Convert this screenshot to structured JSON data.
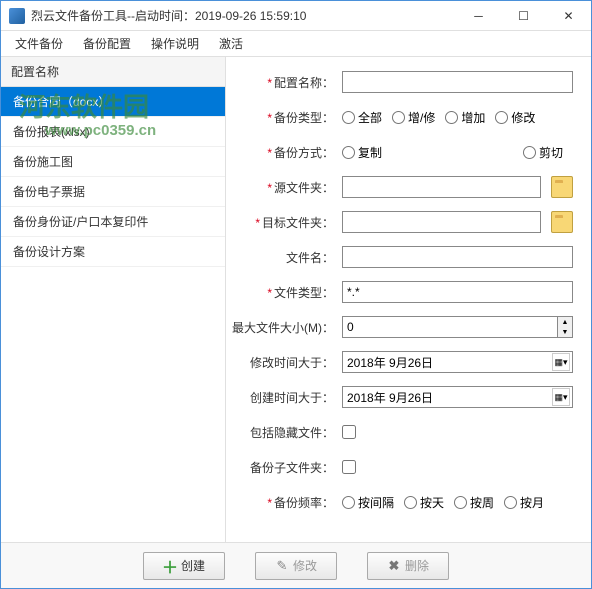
{
  "window": {
    "title": "烈云文件备份工具--启动时间：2019-09-26 15:59:10"
  },
  "menu": {
    "file_backup": "文件备份",
    "backup_config": "备份配置",
    "operation_help": "操作说明",
    "activate": "激活"
  },
  "sidebar": {
    "header": "配置名称",
    "items": [
      "备份合同（docx）",
      "备份报表(xlsx)",
      "备份施工图",
      "备份电子票据",
      "备份身份证/户口本复印件",
      "备份设计方案"
    ]
  },
  "form": {
    "config_name": {
      "label": "配置名称：",
      "value": ""
    },
    "backup_type": {
      "label": "备份类型：",
      "options": [
        "全部",
        "增/修",
        "增加",
        "修改"
      ]
    },
    "backup_mode": {
      "label": "备份方式：",
      "options": [
        "复制",
        "剪切"
      ]
    },
    "source_folder": {
      "label": "源文件夹：",
      "value": ""
    },
    "target_folder": {
      "label": "目标文件夹：",
      "value": ""
    },
    "file_name": {
      "label": "文件名：",
      "value": ""
    },
    "file_type": {
      "label": "文件类型：",
      "value": "*.*"
    },
    "max_file_size": {
      "label": "最大文件大小(M)：",
      "value": "0"
    },
    "modify_time_after": {
      "label": "修改时间大于：",
      "value": "2018年 9月26日"
    },
    "create_time_after": {
      "label": "创建时间大于：",
      "value": "2018年 9月26日"
    },
    "include_hidden": {
      "label": "包括隐藏文件："
    },
    "backup_subfolders": {
      "label": "备份子文件夹："
    },
    "backup_frequency": {
      "label": "备份频率：",
      "options": [
        "按间隔",
        "按天",
        "按周",
        "按月"
      ]
    }
  },
  "buttons": {
    "create": "创建",
    "modify": "修改",
    "delete": "删除"
  },
  "watermark": {
    "line1": "河东软件园",
    "line2": "www.pc0359.cn"
  }
}
